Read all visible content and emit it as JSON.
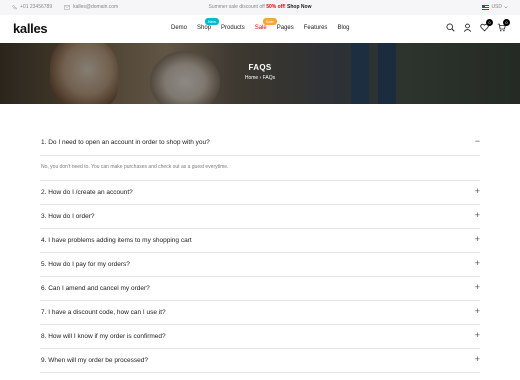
{
  "topbar": {
    "phone": "+01 23456789",
    "email": "kalles@domain.com",
    "promo_text": "Summer sale discount off",
    "promo_highlight": "50% off!",
    "promo_link": "Shop Now",
    "currency": "USD"
  },
  "header": {
    "logo": "kalles",
    "nav": [
      {
        "label": "Demo",
        "badge": ""
      },
      {
        "label": "Shop",
        "badge": "New"
      },
      {
        "label": "Products",
        "badge": ""
      },
      {
        "label": "Sale",
        "badge": "Sale"
      },
      {
        "label": "Pages",
        "badge": ""
      },
      {
        "label": "Features",
        "badge": ""
      },
      {
        "label": "Blog",
        "badge": ""
      }
    ],
    "wishlist_count": "0",
    "cart_count": "0"
  },
  "hero": {
    "title": "FAQS",
    "breadcrumb_home": "Home",
    "breadcrumb_current": "FAQs"
  },
  "faq": {
    "open_question": "1. Do I need to open an account in order to shop with you?",
    "open_answer": "No, you don't need to. You can make purchases and check out as a guest everytime.",
    "questions": [
      "2. How do I /create an account?",
      "3. How do I order?",
      "4. I have problems adding items to my shopping cart",
      "5. How do I pay for my orders?",
      "6. Can I amend and cancel my order?",
      "7. I have a discount code, how can I use it?",
      "8. How will I know if my order is confirmed?",
      "9. When will my order be processed?"
    ],
    "expand_symbol": "+",
    "collapse_symbol": "−"
  },
  "colors": {
    "accent_red": "#ec0101",
    "badge_new": "#01bad4",
    "badge_sale": "#f6a828",
    "topbar_bg": "#f6f6f8"
  },
  "icons": [
    "phone-icon",
    "mail-icon",
    "search-icon",
    "user-icon",
    "heart-icon",
    "cart-icon",
    "chevron-down-icon"
  ]
}
